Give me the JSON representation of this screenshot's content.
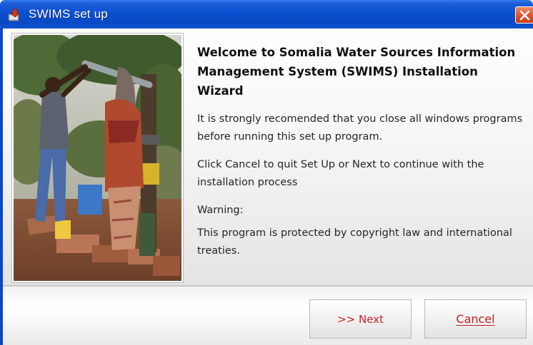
{
  "window": {
    "title": "SWIMS set up"
  },
  "content": {
    "welcome_title": "Welcome to Somalia Water Sources Information Management System (SWIMS) Installation Wizard",
    "recommendation": "It is strongly recomended that you close all windows programs before running this set up program.",
    "instructions": "Click Cancel to quit Set Up or Next to continue with the installation process",
    "warning_label": "Warning:",
    "copyright_notice": "This program is protected by copyright  law and international treaties."
  },
  "buttons": {
    "next_label": ">> Next",
    "cancel_label": "Cancel"
  },
  "colors": {
    "titlebar": "#0a49c4",
    "button_text": "#c62020",
    "close_button": "#e0502a"
  },
  "icons": {
    "app": "setup-app-icon",
    "close": "close-icon"
  }
}
